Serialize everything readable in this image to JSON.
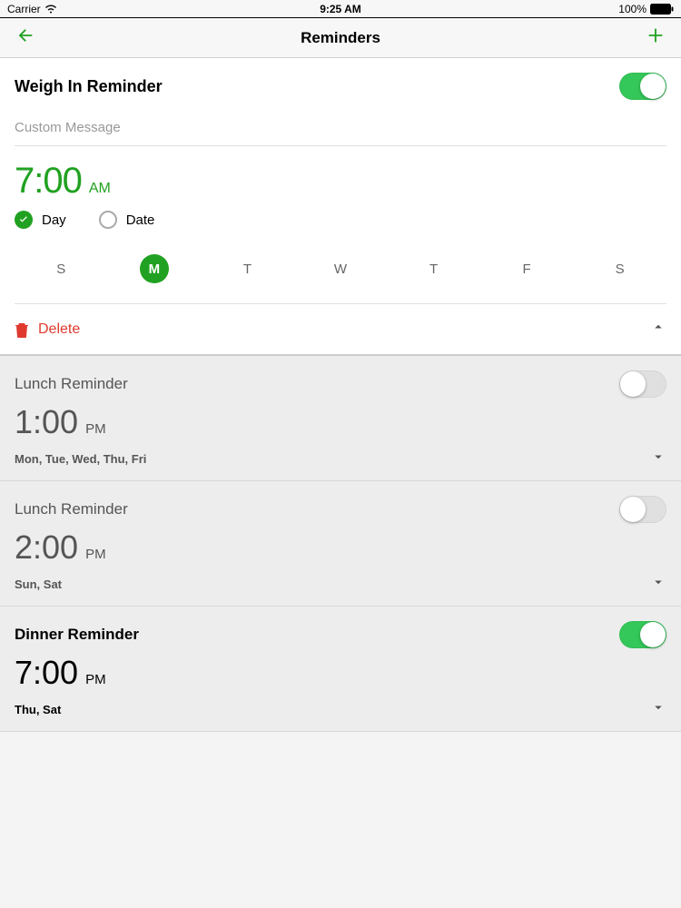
{
  "statusbar": {
    "carrier": "Carrier",
    "time": "9:25 AM",
    "battery": "100%"
  },
  "nav": {
    "title": "Reminders"
  },
  "expanded": {
    "name": "Weigh In Reminder",
    "enabled": true,
    "custom_placeholder": "Custom Message",
    "time": "7:00",
    "ampm": "AM",
    "mode_day_label": "Day",
    "mode_date_label": "Date",
    "mode_selected": "day",
    "days": [
      "S",
      "M",
      "T",
      "W",
      "T",
      "F",
      "S"
    ],
    "days_selected": [
      false,
      true,
      false,
      false,
      false,
      false,
      false
    ],
    "delete_label": "Delete"
  },
  "items": [
    {
      "name": "Lunch Reminder",
      "enabled": false,
      "time": "1:00",
      "ampm": "PM",
      "days": "Mon, Tue, Wed, Thu, Fri"
    },
    {
      "name": "Lunch Reminder",
      "enabled": false,
      "time": "2:00",
      "ampm": "PM",
      "days": "Sun, Sat"
    },
    {
      "name": "Dinner Reminder",
      "enabled": true,
      "time": "7:00",
      "ampm": "PM",
      "days": "Thu, Sat"
    }
  ]
}
